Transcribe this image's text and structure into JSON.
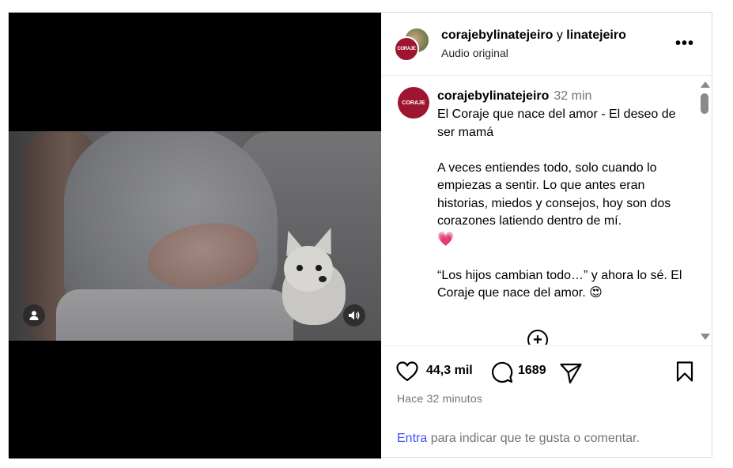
{
  "header": {
    "account_primary": "corajebylinatejeiro",
    "connector": "y",
    "account_secondary": "linatejeiro",
    "audio_label": "Audio original",
    "avatar_logo_text": "CORAJE",
    "more_label": "•••"
  },
  "caption": {
    "avatar_logo_text": "CORAJE",
    "username": "corajebylinatejeiro",
    "time": "32 min",
    "line1": "El Coraje que nace del amor - El deseo de ser mamá",
    "para2": "A veces entiendes todo, solo cuando lo empiezas a sentir. Lo que antes eran historias, miedos y consejos, hoy son dos corazones latiendo dentro de mí.",
    "heart_emoji": "💗",
    "para3": "“Los hijos cambian todo…” y ahora lo sé. El Coraje que nace del amor.",
    "face_emoji": "😍",
    "add_comment_label": "+"
  },
  "actions": {
    "likes": "44,3 mil",
    "comments": "1689",
    "posted": "Hace 32 minutos"
  },
  "login": {
    "link": "Entra",
    "rest": " para indicar que te gusta o comentar."
  },
  "icons": {
    "like": "heart-icon",
    "comment": "comment-icon",
    "share": "send-icon",
    "save": "bookmark-icon",
    "user": "user-icon",
    "sound": "speaker-icon"
  },
  "colors": {
    "brand": "#9e1530",
    "link": "#4150f7",
    "muted": "#737373"
  }
}
